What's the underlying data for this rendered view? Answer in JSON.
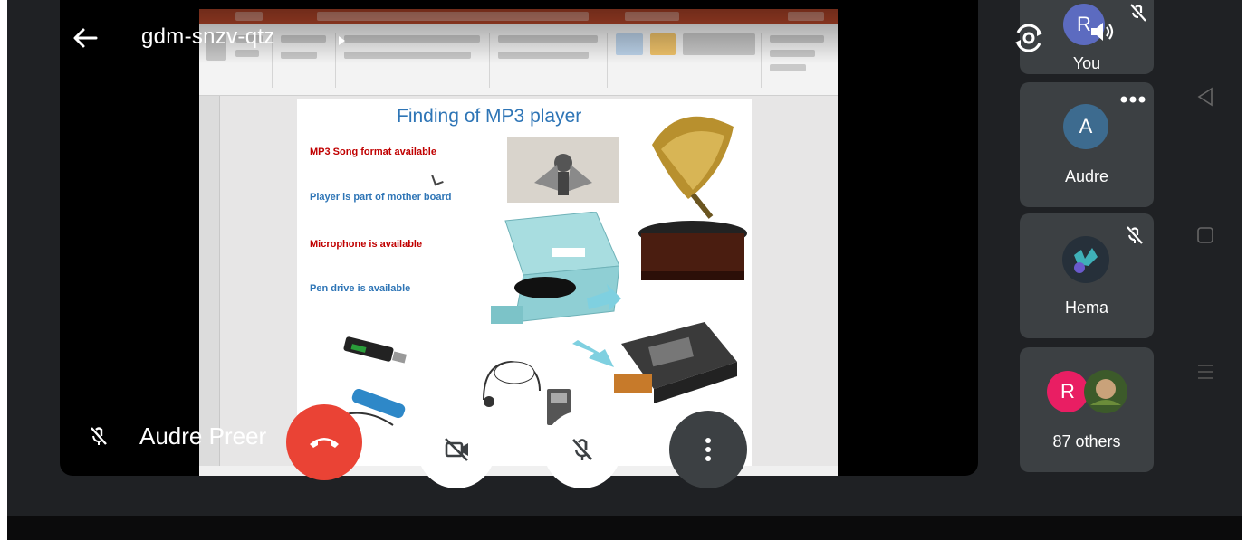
{
  "meeting": {
    "code": "gdm-snzv-qtz",
    "presenter_name": "Audre Preer"
  },
  "slide": {
    "title": "Finding of MP3 player",
    "bullets": [
      "MP3 Song format available",
      "Player is part of mother board",
      "Microphone is available",
      "Pen drive is available"
    ]
  },
  "participants": {
    "self_label": "You",
    "self_initial": "R",
    "audre_initial": "A",
    "audre_name": "Audre",
    "hema_name": "Hema",
    "others_initial": "R",
    "others_label": "87 others"
  },
  "colors": {
    "end_call": "#ea4335",
    "tile_bg": "#3c4043",
    "self_avatar": "#5c6bc0",
    "audre_avatar": "#3d6b8f",
    "others_avatar": "#e91e63"
  },
  "icons": {
    "back": "arrow-left-icon",
    "switch_camera": "camera-switch-icon",
    "end_call": "phone-hangup-icon",
    "camera_off": "video-off-icon",
    "mic_off": "mic-off-icon",
    "more": "more-vertical-icon"
  }
}
